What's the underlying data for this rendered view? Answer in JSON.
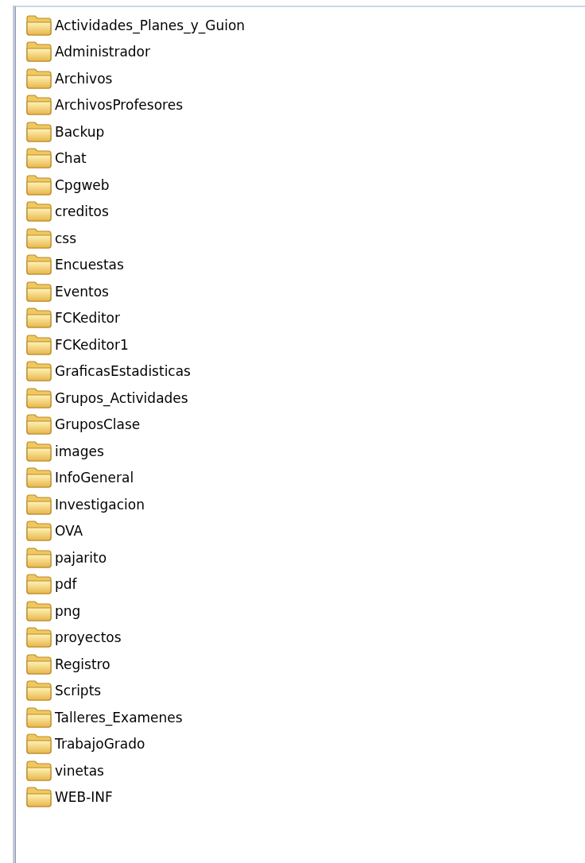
{
  "folders": [
    {
      "name": "Actividades_Planes_y_Guion"
    },
    {
      "name": "Administrador"
    },
    {
      "name": "Archivos"
    },
    {
      "name": "ArchivosProfesores"
    },
    {
      "name": "Backup"
    },
    {
      "name": "Chat"
    },
    {
      "name": "Cpgweb"
    },
    {
      "name": "creditos"
    },
    {
      "name": "css"
    },
    {
      "name": "Encuestas"
    },
    {
      "name": "Eventos"
    },
    {
      "name": "FCKeditor"
    },
    {
      "name": "FCKeditor1"
    },
    {
      "name": "GraficasEstadisticas"
    },
    {
      "name": "Grupos_Actividades"
    },
    {
      "name": "GruposClase"
    },
    {
      "name": "images"
    },
    {
      "name": "InfoGeneral"
    },
    {
      "name": "Investigacion"
    },
    {
      "name": "OVA"
    },
    {
      "name": "pajarito"
    },
    {
      "name": "pdf"
    },
    {
      "name": "png"
    },
    {
      "name": "proyectos"
    },
    {
      "name": "Registro"
    },
    {
      "name": "Scripts"
    },
    {
      "name": "Talleres_Examenes"
    },
    {
      "name": "TrabajoGrado"
    },
    {
      "name": "vinetas"
    },
    {
      "name": "WEB-INF"
    }
  ]
}
